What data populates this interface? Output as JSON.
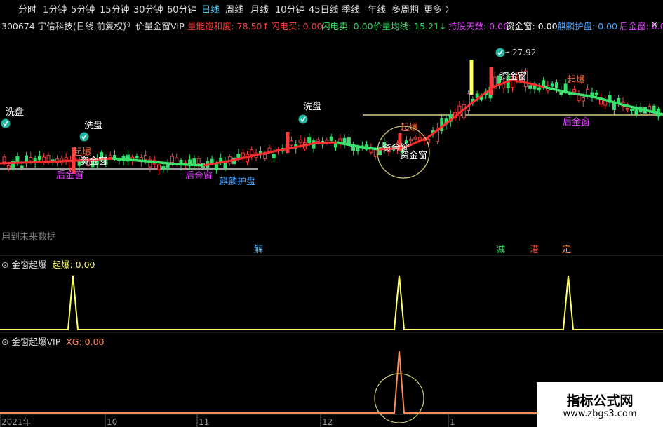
{
  "toolbar": {
    "tabs": [
      "分时",
      "1分钟",
      "5分钟",
      "15分钟",
      "30分钟",
      "60分钟",
      "日线",
      "周线",
      "月线",
      "10分钟",
      "45日线",
      "季线",
      "年线",
      "多周期",
      "更多 〉"
    ],
    "active_tab": "日线"
  },
  "header": {
    "stock": "300674 宇信科技(日线,前复权)",
    "indicator": "价量金窗VIP",
    "items": [
      {
        "label": "量能饱和度: 78.50",
        "arrow": "↑",
        "color": "#ff3b3b"
      },
      {
        "label": "闪电买: 0.00",
        "color": "#ff3b3b"
      },
      {
        "label": "闪电卖: 0.00",
        "color": "#35e06a"
      },
      {
        "label": "价量均线: 15.21",
        "arrow": "↓",
        "color": "#35e06a"
      },
      {
        "label": "持股天数: 0.00",
        "color": "#e040fb"
      },
      {
        "label": "资金窗: 0.00",
        "color": "#ffffff"
      },
      {
        "label": "麒麟护盘: 0.00",
        "color": "#4aa3ff"
      },
      {
        "label": "后金窗: 0.00",
        "color": "#e040fb"
      }
    ],
    "close_icon": "⊗"
  },
  "main_chart": {
    "price_label": "27.92",
    "top_label": "洗盘",
    "annotations": [
      {
        "text": "洗盘",
        "color": "#ffffff"
      },
      {
        "text": "洗盘",
        "color": "#ffffff"
      },
      {
        "text": "洗盘",
        "color": "#ffffff"
      },
      {
        "text": "起爆",
        "color": "#ff6a3d"
      },
      {
        "text": "资金窗",
        "color": "#ffffff"
      },
      {
        "text": "后金窗",
        "color": "#e040fb"
      },
      {
        "text": "后金窗",
        "color": "#e040fb"
      },
      {
        "text": "麒麟护盘",
        "color": "#4aa3ff"
      },
      {
        "text": "起爆",
        "color": "#ff6a3d"
      },
      {
        "text": "资金窗",
        "color": "#ffffff"
      },
      {
        "text": "资金窗",
        "color": "#ffffff"
      },
      {
        "text": "资金窗",
        "color": "#ffffff"
      },
      {
        "text": "起爆",
        "color": "#ff6a3d"
      },
      {
        "text": "后金窗",
        "color": "#e040fb"
      }
    ],
    "future_note": "用到未来数据",
    "markers": [
      {
        "text": "解",
        "color": "#3fb6ff"
      },
      {
        "text": "减",
        "color": "#35e06a"
      },
      {
        "text": "港",
        "color": "#ff3b3b"
      },
      {
        "text": "定",
        "color": "#ff8c3b"
      }
    ]
  },
  "panel1": {
    "name": "金窗起爆",
    "series_label": "起爆: 0.00"
  },
  "panel2": {
    "name": "金窗起爆VIP",
    "series_label": "XG: 0.00"
  },
  "x_axis": {
    "labels": [
      "2021年",
      "10",
      "11",
      "12",
      "1"
    ]
  },
  "watermark": {
    "title": "指标公式网",
    "url": "www.zbgs3.com"
  },
  "chart_data": [
    {
      "type": "line",
      "title": "金窗起爆",
      "series": [
        {
          "name": "起爆",
          "x": [
            1,
            2,
            3
          ],
          "values": [
            1,
            1,
            1
          ]
        }
      ]
    },
    {
      "type": "line",
      "title": "金窗起爆VIP",
      "series": [
        {
          "name": "XG",
          "x": [
            1
          ],
          "values": [
            1
          ]
        }
      ]
    }
  ]
}
